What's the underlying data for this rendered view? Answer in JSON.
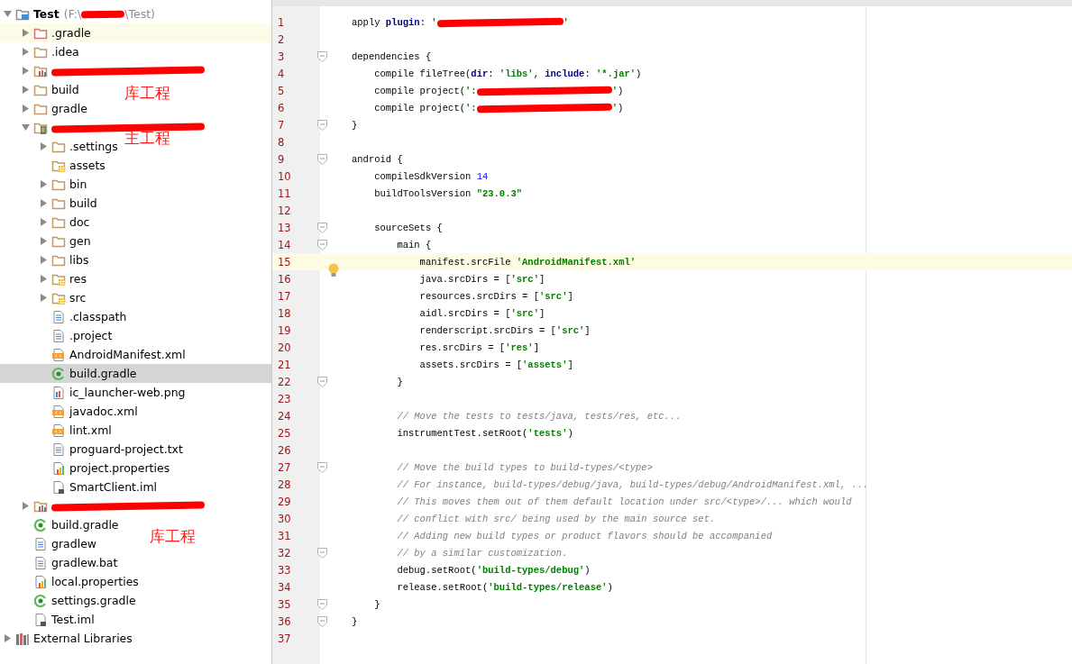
{
  "project_tree": {
    "nodes": [
      {
        "kind": "project",
        "label": "Test",
        "path": [
          {
            "kind": "text",
            "text": "(F:\\"
          },
          {
            "kind": "redacted"
          },
          {
            "kind": "text",
            "text": "\\Test)"
          }
        ],
        "expanded": true,
        "selected": false,
        "children": [
          {
            "kind": "excluded-folder",
            "label": ".gradle",
            "expanded": false,
            "selected": false,
            "caret_row": true
          },
          {
            "kind": "folder",
            "label": ".idea",
            "expanded": false,
            "selected": false
          },
          {
            "kind": "module",
            "redacted": true,
            "expanded": false,
            "selected": false
          },
          {
            "kind": "folder",
            "label": "build",
            "expanded": false,
            "selected": false
          },
          {
            "kind": "folder",
            "label": "gradle",
            "expanded": false,
            "selected": false
          },
          {
            "kind": "app-module",
            "redacted": true,
            "expanded": true,
            "selected": false,
            "children": [
              {
                "kind": "folder",
                "label": ".settings",
                "expanded": false,
                "selected": false
              },
              {
                "kind": "resource-folder",
                "label": "assets",
                "selected": false
              },
              {
                "kind": "folder",
                "label": "bin",
                "expanded": false,
                "selected": false
              },
              {
                "kind": "folder",
                "label": "build",
                "expanded": false,
                "selected": false
              },
              {
                "kind": "folder",
                "label": "doc",
                "expanded": false,
                "selected": false
              },
              {
                "kind": "folder",
                "label": "gen",
                "expanded": false,
                "selected": false
              },
              {
                "kind": "folder",
                "label": "libs",
                "expanded": false,
                "selected": false
              },
              {
                "kind": "resource-folder",
                "label": "res",
                "expanded": false,
                "selected": false
              },
              {
                "kind": "resource-folder",
                "label": "src",
                "expanded": false,
                "selected": false
              },
              {
                "kind": "text-file",
                "label": ".classpath",
                "selected": false
              },
              {
                "kind": "text-file",
                "label": ".project",
                "selected": false
              },
              {
                "kind": "xml-file",
                "label": "AndroidManifest.xml",
                "selected": false
              },
              {
                "kind": "gradle-file",
                "label": "build.gradle",
                "selected": true
              },
              {
                "kind": "image-file",
                "label": "ic_launcher-web.png",
                "selected": false
              },
              {
                "kind": "xml-file",
                "label": "javadoc.xml",
                "selected": false
              },
              {
                "kind": "xml-file",
                "label": "lint.xml",
                "selected": false
              },
              {
                "kind": "text-file",
                "label": "proguard-project.txt",
                "selected": false
              },
              {
                "kind": "properties-file",
                "label": "project.properties",
                "selected": false
              },
              {
                "kind": "iml-file",
                "label": "SmartClient.iml",
                "selected": false
              }
            ]
          },
          {
            "kind": "module",
            "redacted": true,
            "expanded": false,
            "selected": false
          },
          {
            "kind": "gradle-file",
            "label": "build.gradle",
            "selected": false
          },
          {
            "kind": "text-file",
            "label": "gradlew",
            "selected": false
          },
          {
            "kind": "text-file",
            "label": "gradlew.bat",
            "selected": false
          },
          {
            "kind": "properties-file",
            "label": "local.properties",
            "selected": false
          },
          {
            "kind": "gradle-file",
            "label": "settings.gradle",
            "selected": false
          },
          {
            "kind": "iml-file",
            "label": "Test.iml",
            "selected": false
          }
        ]
      },
      {
        "kind": "libraries",
        "label": "External Libraries",
        "expanded": false,
        "selected": false
      }
    ],
    "annotations": [
      {
        "text": "库工程"
      },
      {
        "text": "主工程"
      },
      {
        "text": "库工程"
      }
    ]
  },
  "editor": {
    "lines": [
      {
        "number": "1",
        "fold": false,
        "current": false,
        "segments": [
          {
            "kind": "plain",
            "text": "apply "
          },
          {
            "kind": "keyword",
            "text": "plugin"
          },
          {
            "kind": "plain",
            "text": ": "
          },
          {
            "kind": "string",
            "text": "'"
          },
          {
            "kind": "redacted"
          },
          {
            "kind": "string",
            "text": "'"
          }
        ]
      },
      {
        "number": "2",
        "fold": false,
        "current": false
      },
      {
        "number": "3",
        "fold": true,
        "current": false,
        "segments": [
          {
            "kind": "plain",
            "text": "dependencies {"
          }
        ]
      },
      {
        "number": "4",
        "fold": false,
        "current": false,
        "segments": [
          {
            "kind": "plain",
            "text": "    compile fileTree("
          },
          {
            "kind": "keyword",
            "text": "dir"
          },
          {
            "kind": "plain",
            "text": ": "
          },
          {
            "kind": "string",
            "text": "'libs'"
          },
          {
            "kind": "plain",
            "text": ", "
          },
          {
            "kind": "keyword",
            "text": "include"
          },
          {
            "kind": "plain",
            "text": ": "
          },
          {
            "kind": "string",
            "text": "'*.jar'"
          },
          {
            "kind": "plain",
            "text": ")"
          }
        ]
      },
      {
        "number": "5",
        "fold": false,
        "current": false,
        "segments": [
          {
            "kind": "plain",
            "text": "    compile project("
          },
          {
            "kind": "string",
            "text": "':"
          },
          {
            "kind": "redacted"
          },
          {
            "kind": "string",
            "text": "'"
          },
          {
            "kind": "plain",
            "text": ")"
          }
        ]
      },
      {
        "number": "6",
        "fold": false,
        "current": false,
        "segments": [
          {
            "kind": "plain",
            "text": "    compile project("
          },
          {
            "kind": "string",
            "text": "':"
          },
          {
            "kind": "redacted"
          },
          {
            "kind": "string",
            "text": "'"
          },
          {
            "kind": "plain",
            "text": ")"
          }
        ]
      },
      {
        "number": "7",
        "fold": true,
        "current": false,
        "segments": [
          {
            "kind": "plain",
            "text": "}"
          }
        ]
      },
      {
        "number": "8",
        "fold": false,
        "current": false
      },
      {
        "number": "9",
        "fold": true,
        "current": false,
        "segments": [
          {
            "kind": "plain",
            "text": "android {"
          }
        ]
      },
      {
        "number": "10",
        "fold": false,
        "current": false,
        "segments": [
          {
            "kind": "plain",
            "text": "    compileSdkVersion "
          },
          {
            "kind": "number",
            "text": "14"
          }
        ]
      },
      {
        "number": "11",
        "fold": false,
        "current": false,
        "segments": [
          {
            "kind": "plain",
            "text": "    buildToolsVersion "
          },
          {
            "kind": "string",
            "text": "\"23.0.3\""
          }
        ]
      },
      {
        "number": "12",
        "fold": false,
        "current": false
      },
      {
        "number": "13",
        "fold": true,
        "current": false,
        "segments": [
          {
            "kind": "plain",
            "text": "    sourceSets {"
          }
        ]
      },
      {
        "number": "14",
        "fold": true,
        "current": false,
        "segments": [
          {
            "kind": "plain",
            "text": "        main {"
          }
        ]
      },
      {
        "number": "15",
        "fold": false,
        "current": true,
        "segments": [
          {
            "kind": "plain",
            "text": "            manifest.srcFile "
          },
          {
            "kind": "string",
            "text": "'AndroidManifest.xml'"
          }
        ]
      },
      {
        "number": "16",
        "fold": false,
        "current": false,
        "segments": [
          {
            "kind": "plain",
            "text": "            java.srcDirs = ["
          },
          {
            "kind": "string",
            "text": "'src'"
          },
          {
            "kind": "plain",
            "text": "]"
          }
        ]
      },
      {
        "number": "17",
        "fold": false,
        "current": false,
        "segments": [
          {
            "kind": "plain",
            "text": "            resources.srcDirs = ["
          },
          {
            "kind": "string",
            "text": "'src'"
          },
          {
            "kind": "plain",
            "text": "]"
          }
        ]
      },
      {
        "number": "18",
        "fold": false,
        "current": false,
        "segments": [
          {
            "kind": "plain",
            "text": "            aidl.srcDirs = ["
          },
          {
            "kind": "string",
            "text": "'src'"
          },
          {
            "kind": "plain",
            "text": "]"
          }
        ]
      },
      {
        "number": "19",
        "fold": false,
        "current": false,
        "segments": [
          {
            "kind": "plain",
            "text": "            renderscript.srcDirs = ["
          },
          {
            "kind": "string",
            "text": "'src'"
          },
          {
            "kind": "plain",
            "text": "]"
          }
        ]
      },
      {
        "number": "20",
        "fold": false,
        "current": false,
        "segments": [
          {
            "kind": "plain",
            "text": "            res.srcDirs = ["
          },
          {
            "kind": "string",
            "text": "'res'"
          },
          {
            "kind": "plain",
            "text": "]"
          }
        ]
      },
      {
        "number": "21",
        "fold": false,
        "current": false,
        "segments": [
          {
            "kind": "plain",
            "text": "            assets.srcDirs = ["
          },
          {
            "kind": "string",
            "text": "'assets'"
          },
          {
            "kind": "plain",
            "text": "]"
          }
        ]
      },
      {
        "number": "22",
        "fold": true,
        "current": false,
        "segments": [
          {
            "kind": "plain",
            "text": "        }"
          }
        ]
      },
      {
        "number": "23",
        "fold": false,
        "current": false
      },
      {
        "number": "24",
        "fold": false,
        "current": false,
        "segments": [
          {
            "kind": "comment",
            "text": "        // Move the tests to tests/java, tests/res, etc..."
          }
        ]
      },
      {
        "number": "25",
        "fold": false,
        "current": false,
        "segments": [
          {
            "kind": "plain",
            "text": "        instrumentTest.setRoot("
          },
          {
            "kind": "string",
            "text": "'tests'"
          },
          {
            "kind": "plain",
            "text": ")"
          }
        ]
      },
      {
        "number": "26",
        "fold": false,
        "current": false
      },
      {
        "number": "27",
        "fold": true,
        "current": false,
        "segments": [
          {
            "kind": "comment",
            "text": "        // Move the build types to build-types/<type>"
          }
        ]
      },
      {
        "number": "28",
        "fold": false,
        "current": false,
        "segments": [
          {
            "kind": "comment",
            "text": "        // For instance, build-types/debug/java, build-types/debug/AndroidManifest.xml, ..."
          }
        ]
      },
      {
        "number": "29",
        "fold": false,
        "current": false,
        "segments": [
          {
            "kind": "comment",
            "text": "        // This moves them out of them default location under src/<type>/... which would"
          }
        ]
      },
      {
        "number": "30",
        "fold": false,
        "current": false,
        "segments": [
          {
            "kind": "comment",
            "text": "        // conflict with src/ being used by the main source set."
          }
        ]
      },
      {
        "number": "31",
        "fold": false,
        "current": false,
        "segments": [
          {
            "kind": "comment",
            "text": "        // Adding new build types or product flavors should be accompanied"
          }
        ]
      },
      {
        "number": "32",
        "fold": true,
        "current": false,
        "segments": [
          {
            "kind": "comment",
            "text": "        // by a similar customization."
          }
        ]
      },
      {
        "number": "33",
        "fold": false,
        "current": false,
        "segments": [
          {
            "kind": "plain",
            "text": "        debug.setRoot("
          },
          {
            "kind": "string",
            "text": "'build-types/debug'"
          },
          {
            "kind": "plain",
            "text": ")"
          }
        ]
      },
      {
        "number": "34",
        "fold": false,
        "current": false,
        "segments": [
          {
            "kind": "plain",
            "text": "        release.setRoot("
          },
          {
            "kind": "string",
            "text": "'build-types/release'"
          },
          {
            "kind": "plain",
            "text": ")"
          }
        ]
      },
      {
        "number": "35",
        "fold": true,
        "current": false,
        "segments": [
          {
            "kind": "plain",
            "text": "    }"
          }
        ]
      },
      {
        "number": "36",
        "fold": true,
        "current": false,
        "segments": [
          {
            "kind": "plain",
            "text": "}"
          }
        ]
      },
      {
        "number": "37",
        "fold": false,
        "current": false
      }
    ]
  }
}
